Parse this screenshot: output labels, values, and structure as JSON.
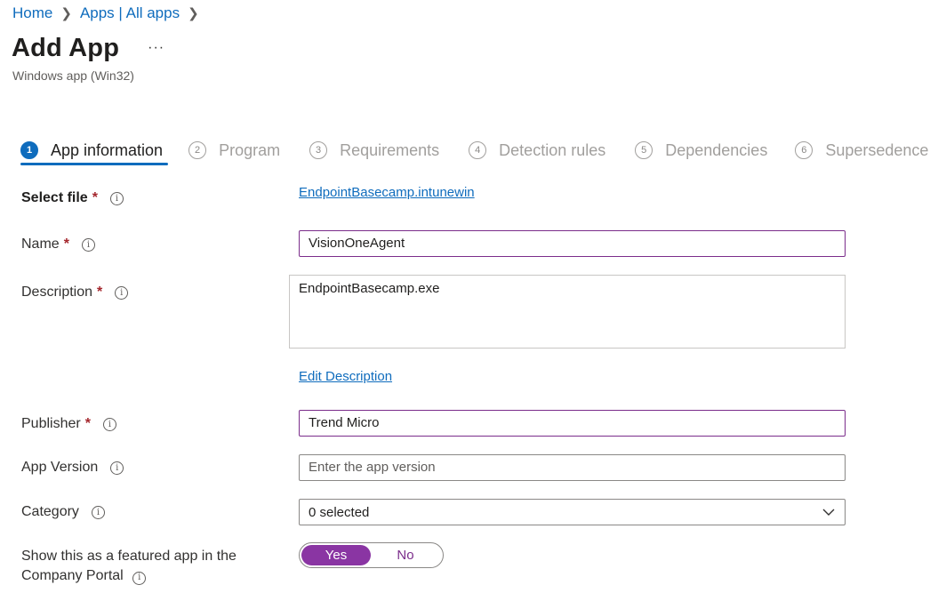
{
  "breadcrumb": {
    "home": "Home",
    "apps": "Apps | All apps"
  },
  "header": {
    "title": "Add App",
    "subtitle": "Windows app (Win32)",
    "more": "···"
  },
  "steps": [
    {
      "num": "1",
      "label": "App information"
    },
    {
      "num": "2",
      "label": "Program"
    },
    {
      "num": "3",
      "label": "Requirements"
    },
    {
      "num": "4",
      "label": "Detection rules"
    },
    {
      "num": "5",
      "label": "Dependencies"
    },
    {
      "num": "6",
      "label": "Supersedence"
    }
  ],
  "form": {
    "select_file": {
      "label": "Select file",
      "value": "EndpointBasecamp.intunewin"
    },
    "name": {
      "label": "Name",
      "value": "VisionOneAgent"
    },
    "description": {
      "label": "Description",
      "value": "EndpointBasecamp.exe",
      "edit_link": "Edit Description"
    },
    "publisher": {
      "label": "Publisher",
      "value": "Trend Micro"
    },
    "app_version": {
      "label": "App Version",
      "placeholder": "Enter the app version"
    },
    "category": {
      "label": "Category",
      "value": "0 selected"
    },
    "featured": {
      "label": "Show this as a featured app in the Company Portal",
      "yes": "Yes",
      "no": "No",
      "selected": "Yes"
    }
  },
  "colors": {
    "accent": "#0f6cbd",
    "toggle_on": "#8a35a3",
    "required": "#a4262c"
  }
}
